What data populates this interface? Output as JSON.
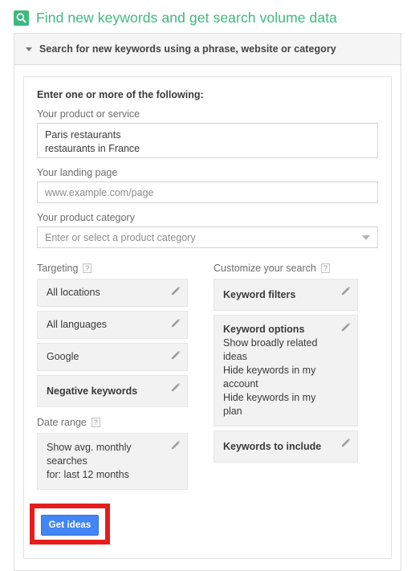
{
  "page": {
    "title": "Find new keywords and get search volume data",
    "title_icon": "search-icon",
    "accent_green": "#3cba7c",
    "button_blue": "#4285f4",
    "annotation_red": "#e81c1c"
  },
  "panel": {
    "header_label": "Search for new keywords using a phrase, website or category",
    "toggle_icon": "triangle-down-icon"
  },
  "form": {
    "heading": "Enter one or more of the following:",
    "product_or_service": {
      "label": "Your product or service",
      "value_line_1": "Paris restaurants",
      "value_line_2": "restaurants in France"
    },
    "landing_page": {
      "label": "Your landing page",
      "placeholder": "www.example.com/page",
      "value": ""
    },
    "product_category": {
      "label": "Your product category",
      "placeholder": "Enter or select a product category",
      "value": "",
      "caret_icon": "chevron-down-icon"
    }
  },
  "targeting": {
    "title": "Targeting",
    "help_label": "?",
    "tiles": [
      {
        "name": "locations",
        "line_1": "All locations",
        "bold": false,
        "edit_icon": "pencil-icon"
      },
      {
        "name": "languages",
        "line_1": "All languages",
        "bold": false,
        "edit_icon": "pencil-icon"
      },
      {
        "name": "search-network",
        "line_1": "Google",
        "bold": false,
        "edit_icon": "pencil-icon"
      },
      {
        "name": "negative-keywords",
        "line_1": "Negative keywords",
        "bold": true,
        "edit_icon": "pencil-icon"
      }
    ]
  },
  "date_range": {
    "title": "Date range",
    "help_label": "?",
    "tile": {
      "line_1": "Show avg. monthly searches",
      "line_2": "for: last 12 months",
      "edit_icon": "pencil-icon"
    }
  },
  "customize": {
    "title": "Customize your search",
    "help_label": "?",
    "keyword_filters": {
      "title": "Keyword filters",
      "edit_icon": "pencil-icon"
    },
    "keyword_options": {
      "title": "Keyword options",
      "options": [
        "Show broadly related ideas",
        "Hide keywords in my account",
        "Hide keywords in my plan"
      ],
      "edit_icon": "pencil-icon"
    },
    "keywords_to_include": {
      "title": "Keywords to include",
      "edit_icon": "pencil-icon"
    }
  },
  "actions": {
    "get_ideas_label": "Get ideas"
  }
}
